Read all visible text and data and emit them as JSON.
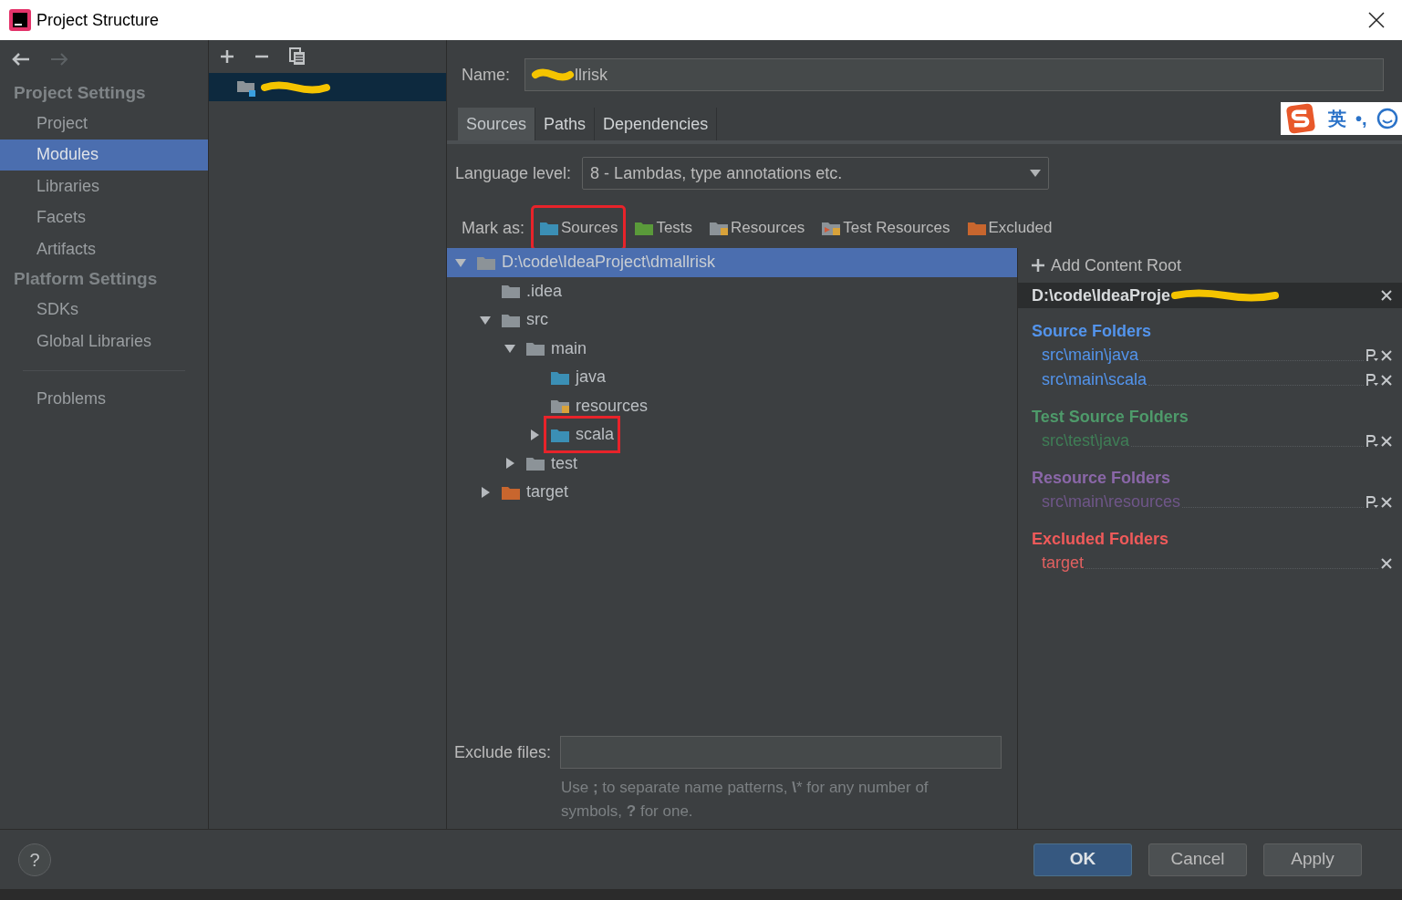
{
  "window": {
    "title": "Project Structure"
  },
  "sidebar": {
    "sections": [
      {
        "title": "Project Settings",
        "items": [
          {
            "label": "Project",
            "selected": false
          },
          {
            "label": "Modules",
            "selected": true
          },
          {
            "label": "Libraries",
            "selected": false
          },
          {
            "label": "Facets",
            "selected": false
          },
          {
            "label": "Artifacts",
            "selected": false
          }
        ]
      },
      {
        "title": "Platform Settings",
        "items": [
          {
            "label": "SDKs",
            "selected": false
          },
          {
            "label": "Global Libraries",
            "selected": false
          }
        ]
      }
    ],
    "extra_items": [
      {
        "label": "Problems",
        "selected": false
      }
    ]
  },
  "name_field": {
    "label": "Name:",
    "value": "llrisk"
  },
  "tabs": [
    {
      "label": "Sources",
      "selected": true
    },
    {
      "label": "Paths",
      "selected": false
    },
    {
      "label": "Dependencies",
      "selected": false
    }
  ],
  "language_level": {
    "label": "Language level:",
    "value": "8 - Lambdas, type annotations etc."
  },
  "mark_as": {
    "label": "Mark as:",
    "buttons": [
      {
        "label": "Sources",
        "kind": "source",
        "highlighted": true
      },
      {
        "label": "Tests",
        "kind": "test",
        "highlighted": false
      },
      {
        "label": "Resources",
        "kind": "resource",
        "highlighted": false
      },
      {
        "label": "Test Resources",
        "kind": "testresource",
        "highlighted": false
      },
      {
        "label": "Excluded",
        "kind": "excluded",
        "highlighted": false
      }
    ]
  },
  "tree": [
    {
      "label": "D:\\code\\IdeaProject\\dmallrisk",
      "kind": "plain",
      "expanded": true,
      "selected": true,
      "highlighted": false,
      "children": [
        {
          "label": ".idea",
          "kind": "plain",
          "selected": false,
          "highlighted": false
        },
        {
          "label": "src",
          "kind": "plain",
          "expanded": true,
          "selected": false,
          "highlighted": false,
          "children": [
            {
              "label": "main",
              "kind": "plain",
              "expanded": true,
              "selected": false,
              "highlighted": false,
              "children": [
                {
                  "label": "java",
                  "kind": "source",
                  "selected": false,
                  "highlighted": false
                },
                {
                  "label": "resources",
                  "kind": "resource",
                  "selected": false,
                  "highlighted": false
                },
                {
                  "label": "scala",
                  "kind": "source",
                  "expanded": false,
                  "selected": false,
                  "highlighted": true
                }
              ]
            },
            {
              "label": "test",
              "kind": "plain",
              "expanded": false,
              "selected": false,
              "highlighted": false
            }
          ]
        },
        {
          "label": "target",
          "kind": "excluded",
          "expanded": false,
          "selected": false,
          "highlighted": false
        }
      ]
    }
  ],
  "exclude_files": {
    "label": "Exclude files:",
    "hint": "Use **;** to separate name patterns, **\\*** for any number of symbols, **?** for one."
  },
  "content_root": {
    "add_label": "Add Content Root",
    "path": "D:\\code\\IdeaProje",
    "sections": [
      {
        "title": "Source Folders",
        "kind": "source",
        "folders": [
          {
            "path": "src\\main\\java",
            "has_properties": true
          },
          {
            "path": "src\\main\\scala",
            "has_properties": true
          }
        ]
      },
      {
        "title": "Test Source Folders",
        "kind": "test",
        "folders": [
          {
            "path": "src\\test\\java",
            "has_properties": true
          }
        ]
      },
      {
        "title": "Resource Folders",
        "kind": "resource",
        "folders": [
          {
            "path": "src\\main\\resources",
            "has_properties": true
          }
        ]
      },
      {
        "title": "Excluded Folders",
        "kind": "excluded",
        "folders": [
          {
            "path": "target",
            "has_properties": false
          }
        ]
      }
    ]
  },
  "ime_toolbar": {
    "language": "英",
    "punctuation": "•,"
  },
  "buttons": [
    {
      "label": "OK",
      "kind": "primary"
    },
    {
      "label": "Cancel",
      "kind": "normal"
    },
    {
      "label": "Apply",
      "kind": "normal"
    }
  ],
  "help": {
    "label": "?"
  }
}
